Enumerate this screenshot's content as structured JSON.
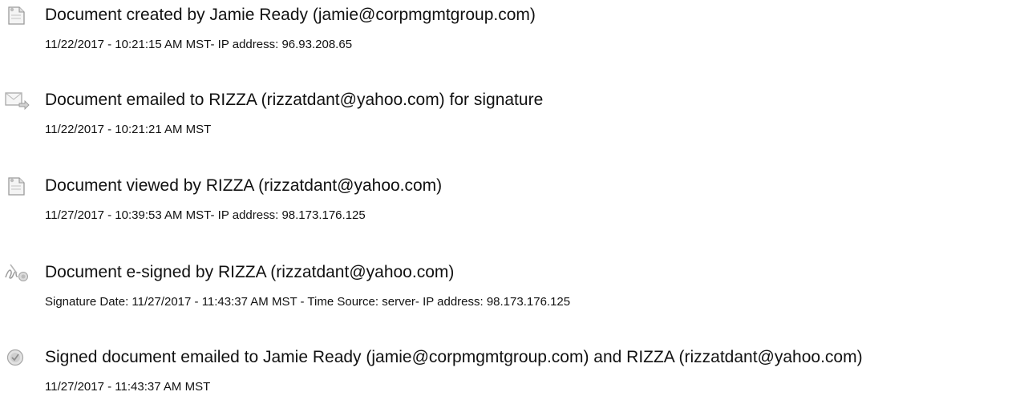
{
  "events": [
    {
      "icon": "document-created-icon",
      "title": "Document created by Jamie Ready (jamie@corpmgmtgroup.com)",
      "detail": "11/22/2017 - 10:21:15 AM MST- IP address: 96.93.208.65"
    },
    {
      "icon": "document-emailed-icon",
      "title": "Document emailed to RIZZA (rizzatdant@yahoo.com) for signature",
      "detail": "11/22/2017 - 10:21:21 AM MST"
    },
    {
      "icon": "document-viewed-icon",
      "title": "Document viewed by RIZZA (rizzatdant@yahoo.com)",
      "detail": "11/27/2017 - 10:39:53 AM MST- IP address: 98.173.176.125"
    },
    {
      "icon": "document-esigned-icon",
      "title": "Document e-signed by RIZZA (rizzatdant@yahoo.com)",
      "detail": "Signature Date: 11/27/2017 - 11:43:37 AM MST - Time Source: server- IP address: 98.173.176.125"
    },
    {
      "icon": "signed-document-emailed-icon",
      "title": "Signed document emailed to Jamie Ready (jamie@corpmgmtgroup.com) and RIZZA (rizzatdant@yahoo.com)",
      "detail": "11/27/2017 - 11:43:37 AM MST"
    }
  ]
}
